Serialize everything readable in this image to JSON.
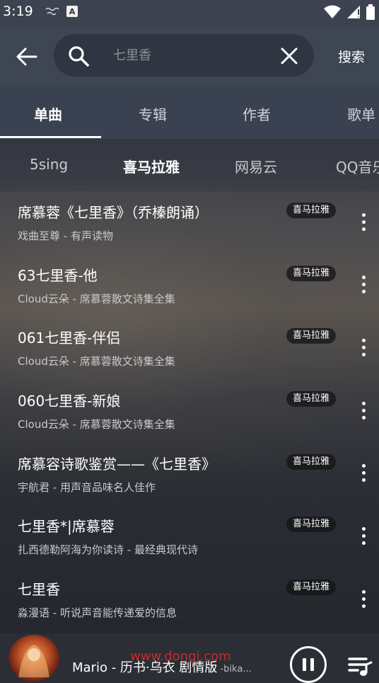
{
  "status_bar": {
    "time": "3:19",
    "notif_icon": "notification-icon",
    "a_icon_text": "A"
  },
  "header": {
    "search_placeholder": "七里香",
    "search_button": "搜索"
  },
  "category_tabs": [
    {
      "label": "单曲",
      "active": true
    },
    {
      "label": "专辑",
      "active": false
    },
    {
      "label": "作者",
      "active": false
    },
    {
      "label": "歌单",
      "active": false
    }
  ],
  "source_tabs": [
    {
      "label": "5sing",
      "active": false
    },
    {
      "label": "喜马拉雅",
      "active": true
    },
    {
      "label": "网易云",
      "active": false
    },
    {
      "label": "QQ音乐",
      "active": false
    }
  ],
  "songs": [
    {
      "title": "席慕蓉《七里香》（乔榛朗诵）",
      "subtitle": "戏曲至尊 - 有声读物",
      "source": "喜马拉雅"
    },
    {
      "title": "63七里香-他",
      "subtitle": "Cloud云朵 - 席慕蓉散文诗集全集",
      "source": "喜马拉雅"
    },
    {
      "title": "061七里香-伴侣",
      "subtitle": "Cloud云朵 - 席慕蓉散文诗集全集",
      "source": "喜马拉雅"
    },
    {
      "title": "060七里香-新娘",
      "subtitle": "Cloud云朵 - 席慕蓉散文诗集全集",
      "source": "喜马拉雅"
    },
    {
      "title": "席慕容诗歌鉴赏——《七里香》",
      "subtitle": "宇航君 - 用声音品味名人佳作",
      "source": "喜马拉雅"
    },
    {
      "title": "七里香*|席慕蓉",
      "subtitle": "扎西德勒阿海为你读诗 - 最经典现代诗",
      "source": "喜马拉雅"
    },
    {
      "title": "七里香",
      "subtitle": "淼漫语 - 听说声音能传递爱的信息",
      "source": "喜马拉雅"
    }
  ],
  "player": {
    "title": "Mario - 历书·乌衣 剧情版",
    "artist": " -bika...",
    "watermark": "www.dongi.com"
  }
}
